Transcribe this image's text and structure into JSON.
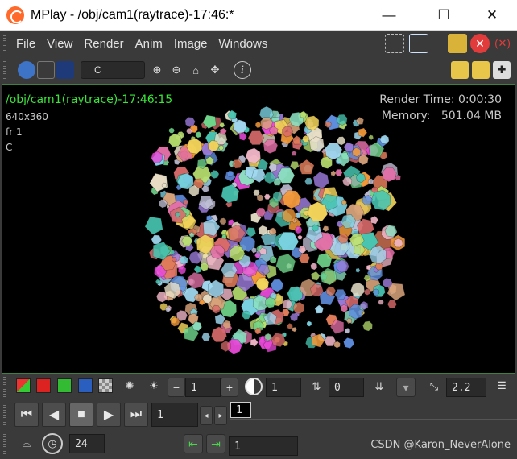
{
  "window": {
    "title": "MPlay - /obj/cam1(raytrace)-17:46:*",
    "minimize_glyph": "—",
    "maximize_glyph": "☐",
    "close_glyph": "✕"
  },
  "menubar": {
    "items": [
      "File",
      "View",
      "Render",
      "Anim",
      "Image",
      "Windows"
    ]
  },
  "toolbar": {
    "channel_value": "C",
    "info_glyph": "i"
  },
  "viewport": {
    "title": "/obj/cam1(raytrace)-17:46:15",
    "resolution": "640x360",
    "frame": "fr 1",
    "channel": "C",
    "render_time": "Render Time: 0:00:30",
    "memory_label": "Memory:",
    "memory_value": "501.04 MB"
  },
  "controls": {
    "minus_label": "−",
    "plus_label": "+",
    "value_a": "1",
    "value_b": "1",
    "value_c": "0",
    "gamma": "2.2",
    "frame_box": "1",
    "current_frame": "1",
    "fps": "24",
    "range_value": "1"
  },
  "watermark": "CSDN @Karon_NeverAlone",
  "colors": {
    "viewport_title": "#39e639",
    "viewport_border": "#3f7f3f",
    "panel_bg": "#3a3a3a"
  }
}
